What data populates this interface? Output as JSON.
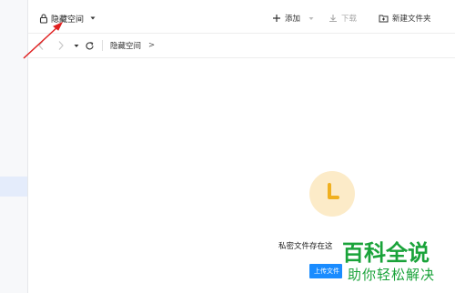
{
  "header": {
    "space_title": "隐藏空间",
    "add_label": "添加",
    "download_label": "下载",
    "new_folder_label": "新建文件夹"
  },
  "breadcrumb": {
    "current": "隐藏空间",
    "separator": ">"
  },
  "empty_state": {
    "message": "私密文件存在这",
    "upload_label": "上传文件"
  },
  "watermark": {
    "logo": "百科全说",
    "subtitle": "助你轻松解决"
  },
  "colors": {
    "accent": "#1a8cff",
    "annotation_arrow": "#e02020",
    "empty_icon_bg": "#fcebc8",
    "empty_icon_fg": "#f0b020",
    "watermark": "#1aa33a"
  },
  "icons": [
    "lock-icon",
    "dropdown-caret-icon",
    "plus-icon",
    "download-icon",
    "new-folder-icon",
    "back-arrow-icon",
    "forward-arrow-icon",
    "history-dropdown-icon",
    "refresh-icon",
    "clock-icon"
  ]
}
